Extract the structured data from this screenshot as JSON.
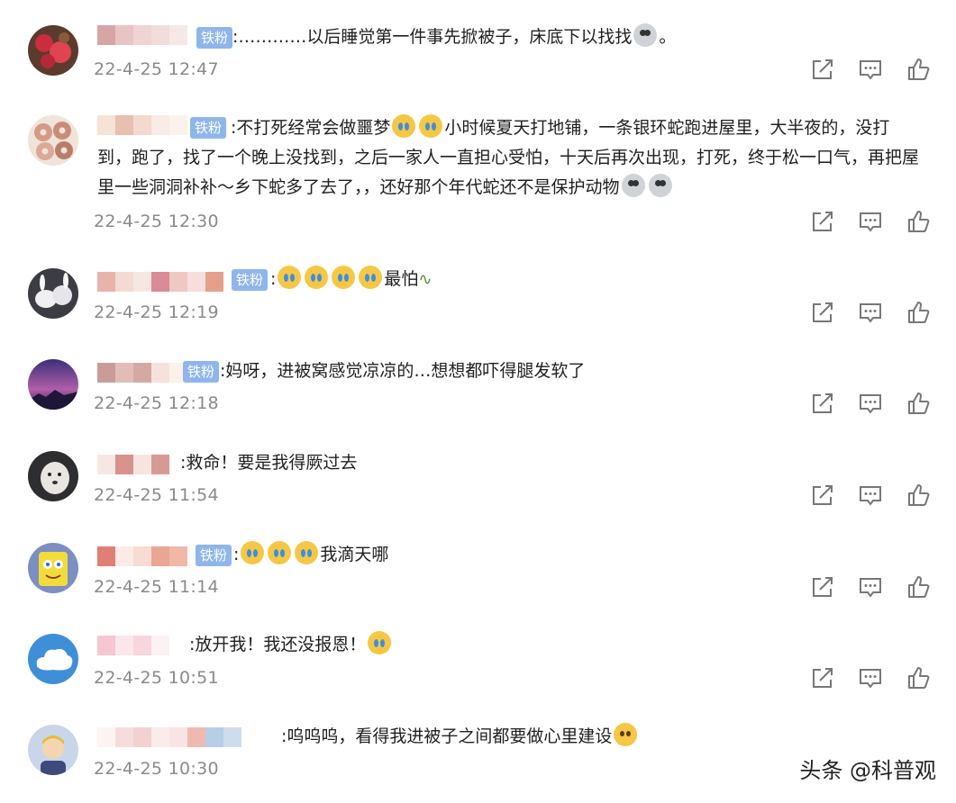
{
  "badge_label": "铁粉",
  "watermark": "头条 @科普观",
  "comments": [
    {
      "parts": [
        "",
        ":…………以后睡觉第一件事先掀被子，床底下以找找",
        "。"
      ],
      "emojis": [
        "scream-emoji"
      ],
      "has_badge": true,
      "time": "22-4-25 12:47",
      "avatar": "red-flower-avatar",
      "name_colors": [
        "#d8a5a5",
        "#e9c4c4",
        "#f0d4d4",
        "#f3dcdc",
        "#f7e8e8"
      ]
    },
    {
      "text": ":不打死经常会做噩梦",
      "text2": "小时候夏天打地铺，一条银环蛇跑进屋里，大半夜的，没打到，跑了，找了一个晚上没找到，之后一家人一直担心受怕，十天后再次出现，打死，终于松一口气，再把屋里一些洞洞补补～乡下蛇多了去了，，还好那个年代蛇还不是保护动物",
      "has_badge": true,
      "time": "22-4-25 12:30",
      "avatar": "donut-avatar",
      "name_colors": [
        "#f7e2d8",
        "#e8c0b0",
        "#f4d9ce",
        "#f9ebe5",
        "#fbf2ee"
      ]
    },
    {
      "text": "最怕",
      "has_badge": true,
      "time": "22-4-25 12:19",
      "avatar": "rabbit-avatar",
      "name_colors": [
        "#e6b4a8",
        "#f3dad3",
        "#f7e7e2",
        "#d98b97",
        "#f0c8c2",
        "#f6dede",
        "#e4a08a"
      ]
    },
    {
      "text": ":妈呀，进被窝感觉凉凉的…想想都吓得腿发软了",
      "has_badge": true,
      "time": "22-4-25 12:18",
      "avatar": "purple-sky-avatar",
      "name_colors": [
        "#c99c98",
        "#e2bcb8",
        "#d6a8a4",
        "#f6e2dc",
        "#fbf1e8"
      ]
    },
    {
      "text": ":救命！要是我得厥过去",
      "has_badge": false,
      "time": "22-4-25 11:54",
      "avatar": "dog-avatar",
      "name_colors": [
        "#f7e6e2",
        "#d8938c",
        "#f6e4df",
        "#d79a92"
      ]
    },
    {
      "text": "我滴天哪",
      "has_badge": true,
      "time": "22-4-25 11:14",
      "avatar": "sponge-avatar",
      "name_colors": [
        "#e07f73",
        "#fbeae5",
        "#f6dcd2",
        "#e8a693",
        "#f0b8a6"
      ]
    },
    {
      "text": ":放开我！我还没报恩！",
      "has_badge": false,
      "time": "22-4-25 10:51",
      "avatar": "cloud-avatar",
      "name_colors": [
        "#f6c6d2",
        "#fbe6ec",
        "#f8d6de",
        "#fdf1f4"
      ]
    },
    {
      "text": ":呜呜呜，看得我进被子之间都要做心里建设",
      "has_badge": false,
      "time": "22-4-25 10:30",
      "avatar": "boy-avatar",
      "name_colors": [
        "#fdf4f2",
        "#f6dcdc",
        "#f3d1d1",
        "#fbecec",
        "#f8e4e2",
        "#f0b9b0",
        "#b8cde8",
        "#cfdcec"
      ]
    }
  ],
  "action_icons": [
    "share-icon",
    "comment-icon",
    "like-icon"
  ]
}
